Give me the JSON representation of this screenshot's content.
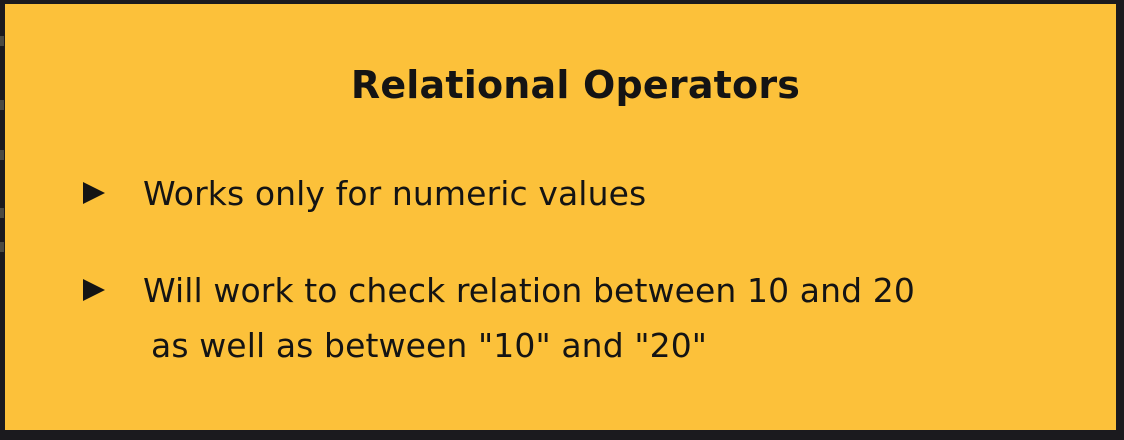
{
  "slide": {
    "title": "Relational Operators",
    "bullets": [
      {
        "lines": [
          "Works only for numeric values"
        ]
      },
      {
        "lines": [
          "Will work to check relation between 10 and 20",
          "as well as between \"10\" and \"20\""
        ]
      }
    ]
  },
  "colors": {
    "slide_background": "#fcc13a",
    "text": "#141414",
    "screen_background": "#1b1a1e"
  },
  "icons": {
    "bullet": "triangle-right-icon"
  }
}
